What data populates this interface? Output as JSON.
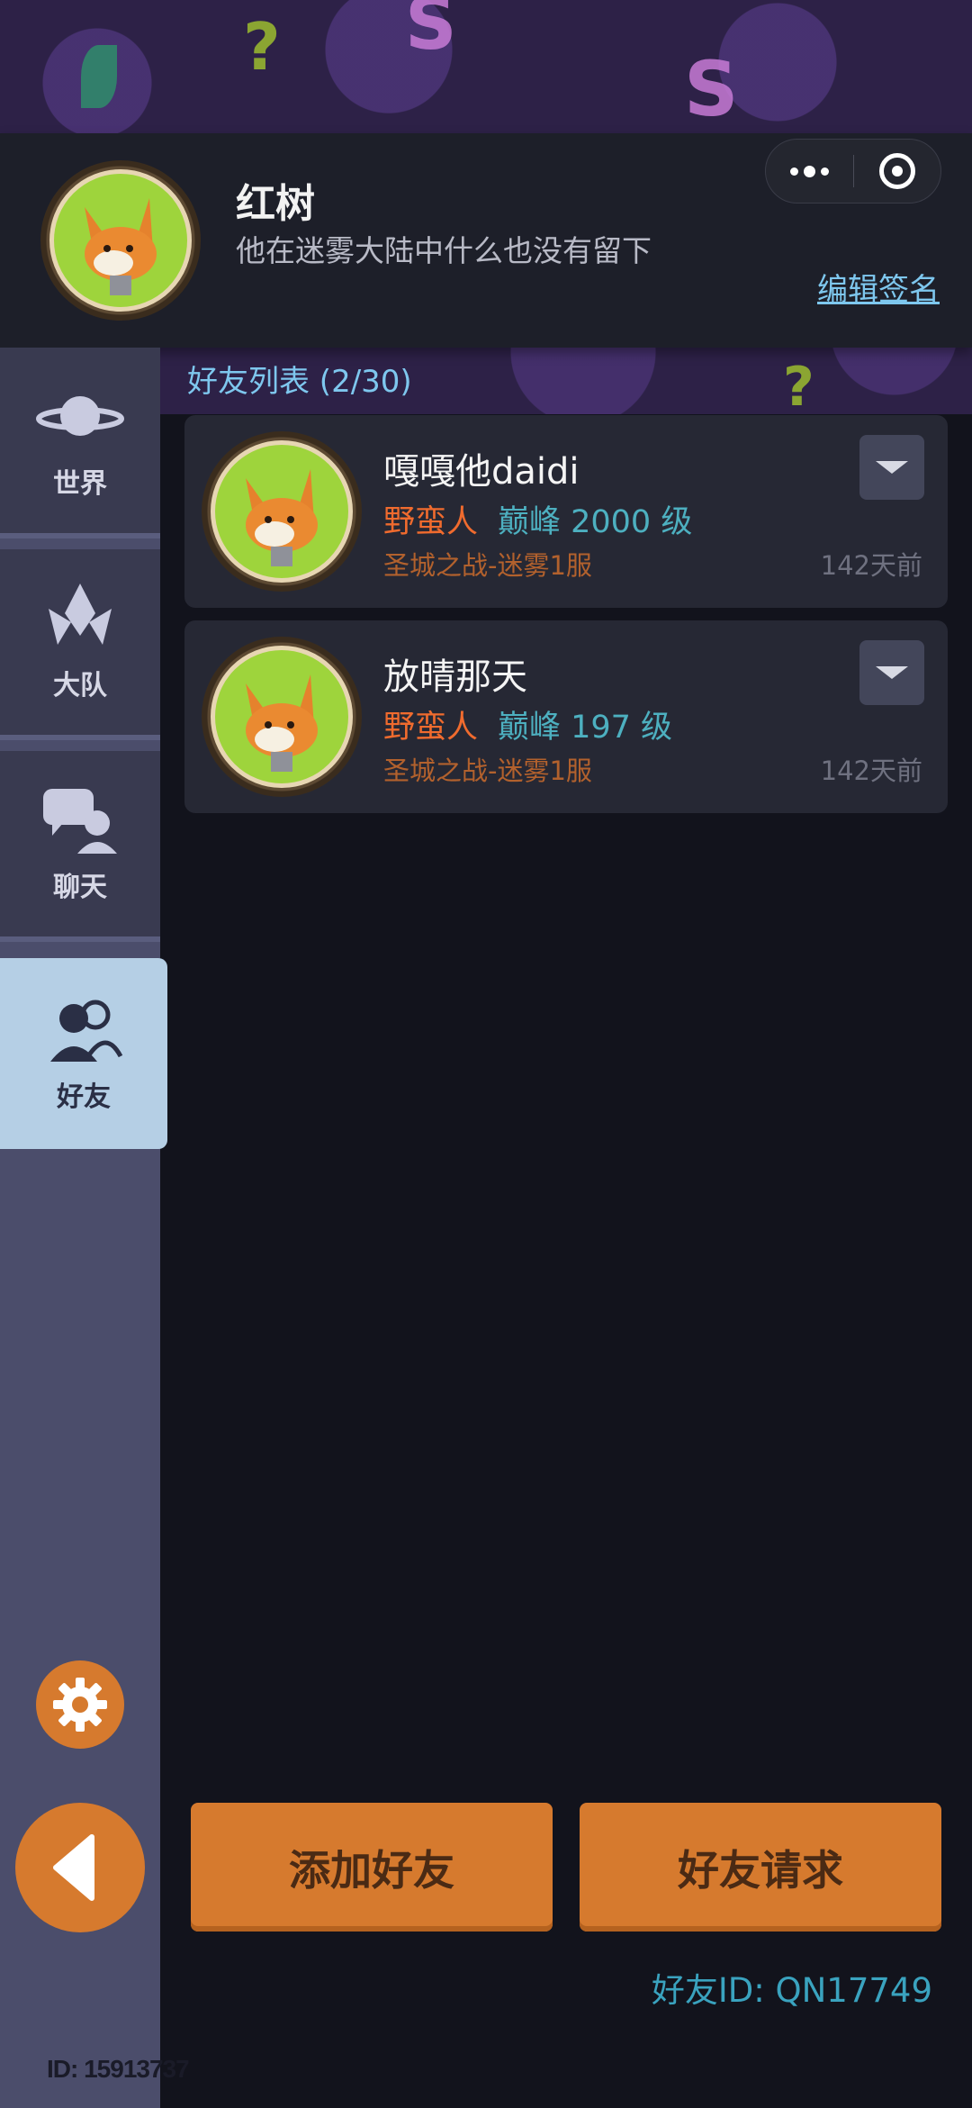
{
  "header": {
    "name": "红树",
    "signature": "他在迷雾大陆中什么也没有留下",
    "edit_signature_link": "编辑签名"
  },
  "sidebar": {
    "items": [
      {
        "label": "世界",
        "icon": "planet-icon"
      },
      {
        "label": "大队",
        "icon": "team-emblem-icon"
      },
      {
        "label": "聊天",
        "icon": "chat-icon"
      },
      {
        "label": "好友",
        "icon": "friends-icon",
        "active": true
      }
    ],
    "user_id_label": "ID: 15913737"
  },
  "friends": {
    "title": "好友列表 (2/30)",
    "list": [
      {
        "name": "嘎嘎他daidi",
        "class": "野蛮人",
        "peak": "巅峰 2000 级",
        "server": "圣城之战-迷雾1服",
        "last_seen": "142天前"
      },
      {
        "name": "放晴那天",
        "class": "野蛮人",
        "peak": "巅峰 197 级",
        "server": "圣城之战-迷雾1服",
        "last_seen": "142天前"
      }
    ]
  },
  "actions": {
    "add_friend": "添加好友",
    "friend_requests": "好友请求"
  },
  "friend_id_label": "好友ID: QN17749",
  "colors": {
    "accent_orange": "#d67a2e",
    "class_text": "#f06b2e",
    "peak_text": "#4db0c0",
    "link_blue": "#7ec7ee",
    "active_tab_bg": "#b5cfe5"
  }
}
